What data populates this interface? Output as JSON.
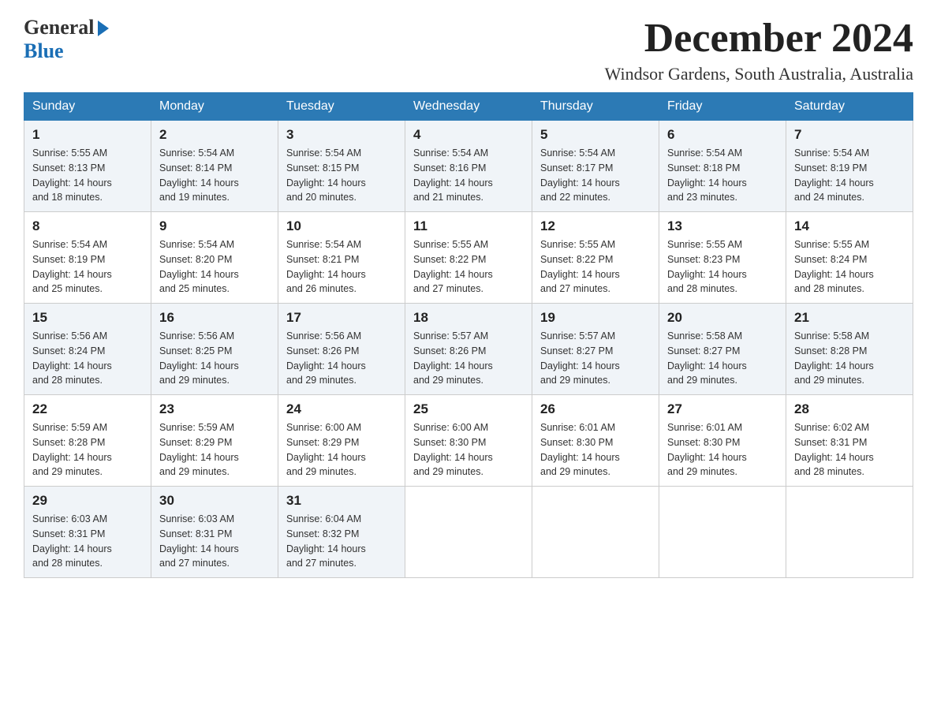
{
  "header": {
    "logo_general": "General",
    "logo_blue": "Blue",
    "month_title": "December 2024",
    "location": "Windsor Gardens, South Australia, Australia"
  },
  "days_of_week": [
    "Sunday",
    "Monday",
    "Tuesday",
    "Wednesday",
    "Thursday",
    "Friday",
    "Saturday"
  ],
  "weeks": [
    [
      {
        "day": "1",
        "sunrise": "5:55 AM",
        "sunset": "8:13 PM",
        "daylight": "14 hours and 18 minutes."
      },
      {
        "day": "2",
        "sunrise": "5:54 AM",
        "sunset": "8:14 PM",
        "daylight": "14 hours and 19 minutes."
      },
      {
        "day": "3",
        "sunrise": "5:54 AM",
        "sunset": "8:15 PM",
        "daylight": "14 hours and 20 minutes."
      },
      {
        "day": "4",
        "sunrise": "5:54 AM",
        "sunset": "8:16 PM",
        "daylight": "14 hours and 21 minutes."
      },
      {
        "day": "5",
        "sunrise": "5:54 AM",
        "sunset": "8:17 PM",
        "daylight": "14 hours and 22 minutes."
      },
      {
        "day": "6",
        "sunrise": "5:54 AM",
        "sunset": "8:18 PM",
        "daylight": "14 hours and 23 minutes."
      },
      {
        "day": "7",
        "sunrise": "5:54 AM",
        "sunset": "8:19 PM",
        "daylight": "14 hours and 24 minutes."
      }
    ],
    [
      {
        "day": "8",
        "sunrise": "5:54 AM",
        "sunset": "8:19 PM",
        "daylight": "14 hours and 25 minutes."
      },
      {
        "day": "9",
        "sunrise": "5:54 AM",
        "sunset": "8:20 PM",
        "daylight": "14 hours and 25 minutes."
      },
      {
        "day": "10",
        "sunrise": "5:54 AM",
        "sunset": "8:21 PM",
        "daylight": "14 hours and 26 minutes."
      },
      {
        "day": "11",
        "sunrise": "5:55 AM",
        "sunset": "8:22 PM",
        "daylight": "14 hours and 27 minutes."
      },
      {
        "day": "12",
        "sunrise": "5:55 AM",
        "sunset": "8:22 PM",
        "daylight": "14 hours and 27 minutes."
      },
      {
        "day": "13",
        "sunrise": "5:55 AM",
        "sunset": "8:23 PM",
        "daylight": "14 hours and 28 minutes."
      },
      {
        "day": "14",
        "sunrise": "5:55 AM",
        "sunset": "8:24 PM",
        "daylight": "14 hours and 28 minutes."
      }
    ],
    [
      {
        "day": "15",
        "sunrise": "5:56 AM",
        "sunset": "8:24 PM",
        "daylight": "14 hours and 28 minutes."
      },
      {
        "day": "16",
        "sunrise": "5:56 AM",
        "sunset": "8:25 PM",
        "daylight": "14 hours and 29 minutes."
      },
      {
        "day": "17",
        "sunrise": "5:56 AM",
        "sunset": "8:26 PM",
        "daylight": "14 hours and 29 minutes."
      },
      {
        "day": "18",
        "sunrise": "5:57 AM",
        "sunset": "8:26 PM",
        "daylight": "14 hours and 29 minutes."
      },
      {
        "day": "19",
        "sunrise": "5:57 AM",
        "sunset": "8:27 PM",
        "daylight": "14 hours and 29 minutes."
      },
      {
        "day": "20",
        "sunrise": "5:58 AM",
        "sunset": "8:27 PM",
        "daylight": "14 hours and 29 minutes."
      },
      {
        "day": "21",
        "sunrise": "5:58 AM",
        "sunset": "8:28 PM",
        "daylight": "14 hours and 29 minutes."
      }
    ],
    [
      {
        "day": "22",
        "sunrise": "5:59 AM",
        "sunset": "8:28 PM",
        "daylight": "14 hours and 29 minutes."
      },
      {
        "day": "23",
        "sunrise": "5:59 AM",
        "sunset": "8:29 PM",
        "daylight": "14 hours and 29 minutes."
      },
      {
        "day": "24",
        "sunrise": "6:00 AM",
        "sunset": "8:29 PM",
        "daylight": "14 hours and 29 minutes."
      },
      {
        "day": "25",
        "sunrise": "6:00 AM",
        "sunset": "8:30 PM",
        "daylight": "14 hours and 29 minutes."
      },
      {
        "day": "26",
        "sunrise": "6:01 AM",
        "sunset": "8:30 PM",
        "daylight": "14 hours and 29 minutes."
      },
      {
        "day": "27",
        "sunrise": "6:01 AM",
        "sunset": "8:30 PM",
        "daylight": "14 hours and 29 minutes."
      },
      {
        "day": "28",
        "sunrise": "6:02 AM",
        "sunset": "8:31 PM",
        "daylight": "14 hours and 28 minutes."
      }
    ],
    [
      {
        "day": "29",
        "sunrise": "6:03 AM",
        "sunset": "8:31 PM",
        "daylight": "14 hours and 28 minutes."
      },
      {
        "day": "30",
        "sunrise": "6:03 AM",
        "sunset": "8:31 PM",
        "daylight": "14 hours and 27 minutes."
      },
      {
        "day": "31",
        "sunrise": "6:04 AM",
        "sunset": "8:32 PM",
        "daylight": "14 hours and 27 minutes."
      },
      null,
      null,
      null,
      null
    ]
  ],
  "labels": {
    "sunrise": "Sunrise:",
    "sunset": "Sunset:",
    "daylight": "Daylight:"
  }
}
